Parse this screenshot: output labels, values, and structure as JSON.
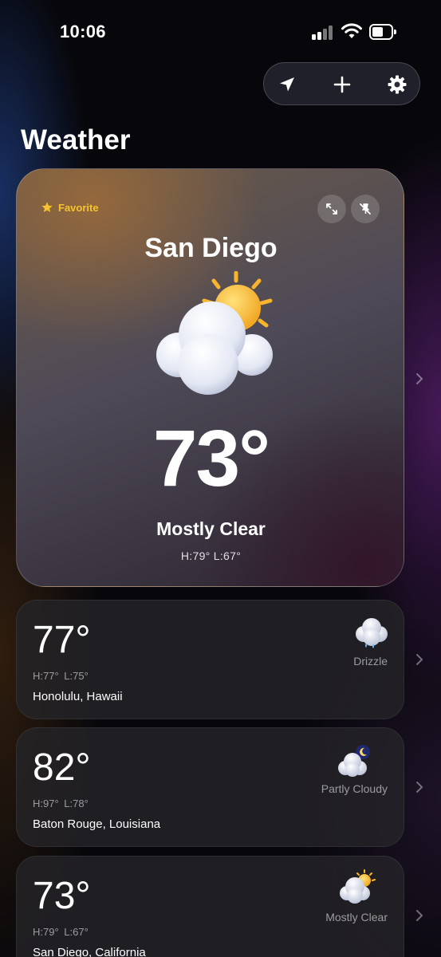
{
  "status_bar": {
    "time": "10:06"
  },
  "page": {
    "title": "Weather"
  },
  "toolbar": {
    "icons": [
      "location-arrow-icon",
      "plus-icon",
      "gear-icon"
    ]
  },
  "hero": {
    "favorite_label": "Favorite",
    "city": "San Diego",
    "temperature": "73°",
    "condition": "Mostly Clear",
    "high_low": "H:79°  L:67°",
    "icon": "partly-sunny-icon"
  },
  "locations": [
    {
      "temperature": "77°",
      "high_low": "H:77°  L:75°",
      "name": "Honolulu, Hawaii",
      "condition": "Drizzle",
      "icon": "drizzle-icon"
    },
    {
      "temperature": "82°",
      "high_low": "H:97°  L:78°",
      "name": "Baton Rouge, Louisiana",
      "condition": "Partly Cloudy",
      "icon": "partly-cloudy-night-icon"
    },
    {
      "temperature": "73°",
      "high_low": "H:79°  L:67°",
      "name": "San Diego, California",
      "condition": "Mostly Clear",
      "icon": "partly-sunny-icon"
    }
  ],
  "colors": {
    "favorite_star": "#f5c330",
    "sun": "#f7b42c",
    "background": "#07070b"
  }
}
